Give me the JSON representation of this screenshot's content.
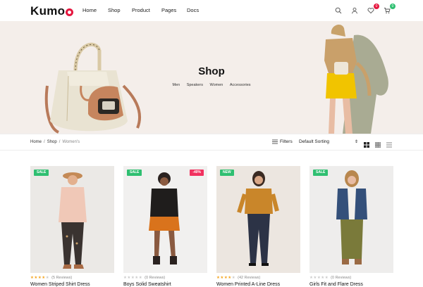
{
  "header": {
    "logo": "Kumo",
    "nav": [
      "Home",
      "Shop",
      "Product",
      "Pages",
      "Docs"
    ],
    "wishlist_count": "0",
    "cart_count": "0"
  },
  "hero": {
    "title": "Shop",
    "links": [
      "Men",
      "Speakers",
      "Women",
      "Accessories"
    ]
  },
  "breadcrumb": [
    "Home",
    "Shop",
    "Women's"
  ],
  "toolbar": {
    "filters_label": "Filters",
    "sort_label": "Default Sorting"
  },
  "products": [
    {
      "tag": "SALE",
      "tag2": "",
      "reviews": "(5 Reviews)",
      "stars": 4,
      "name": "Women Striped Shirt Dress",
      "bg": "#ebe9e6"
    },
    {
      "tag": "SALE",
      "tag2": "-40%",
      "reviews": "(0 Reviews)",
      "stars": 0,
      "name": "Boys Solid Sweatshirt",
      "bg": "#f1f0ef"
    },
    {
      "tag": "NEW",
      "tag2": "",
      "reviews": "(42 Reviews)",
      "stars": 4,
      "name": "Women Printed A-Line Dress",
      "bg": "#ece6e0"
    },
    {
      "tag": "SALE",
      "tag2": "",
      "reviews": "(0 Reviews)",
      "stars": 0,
      "name": "Girls Fit and Flare Dress",
      "bg": "#eeedec"
    }
  ],
  "colors": {
    "sale": "#2fbf71",
    "new": "#2fbf71",
    "discount": "#f1315f",
    "star": "#f5a623",
    "brand": "#e5173f"
  }
}
